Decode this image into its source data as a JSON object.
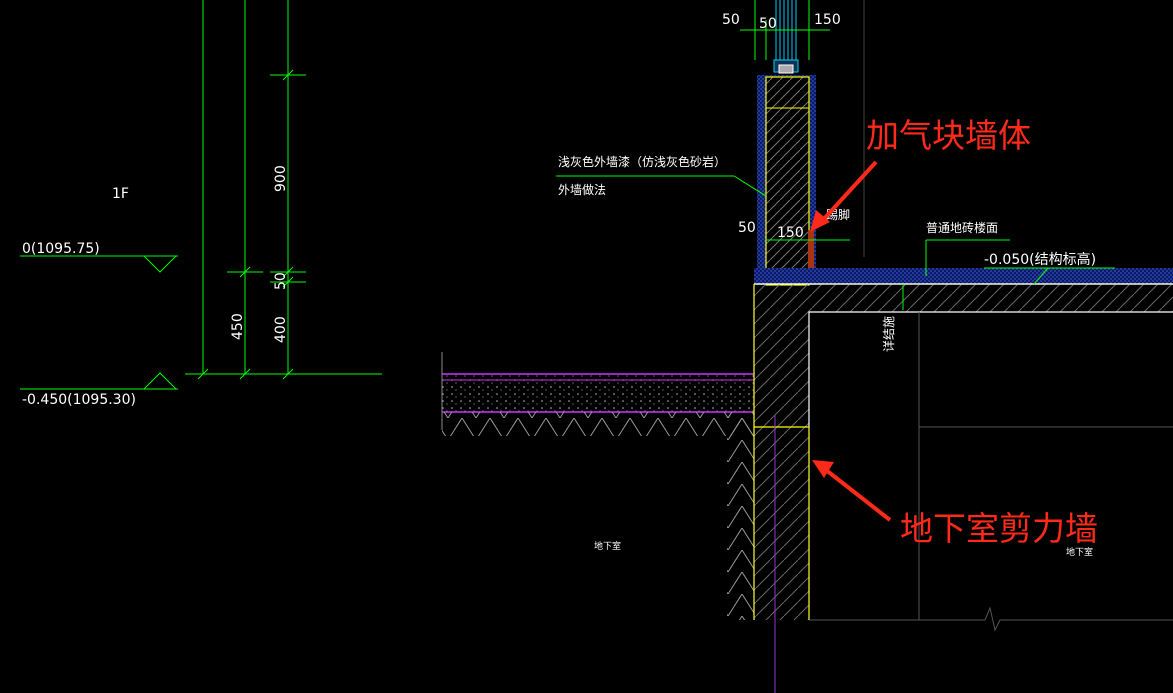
{
  "drawing": {
    "floor_label": "1F",
    "elev_top": "0(1095.75)",
    "elev_bottom": "-0.450(1095.30)",
    "dim_900": "900",
    "dim_50_left": "50",
    "dim_400": "400",
    "dim_450": "450",
    "dim_top_50a": "50",
    "dim_top_50b": "50",
    "dim_top_150": "150",
    "dim_50_mid": "50",
    "dim_150_mid": "150",
    "note_paint": "浅灰色外墙漆（仿浅灰色砂岩）",
    "note_wall_method": "外墙做法",
    "note_skirting": "踢脚",
    "note_floor": "普通地砖楼面",
    "elev_struct": "-0.050(结构标高)",
    "note_structure": "详结施",
    "room_basement_left": "地下室",
    "room_basement_right": "地下室"
  },
  "annotations": {
    "aerated_block_wall": "加气块墙体",
    "basement_shear_wall": "地下室剪力墙"
  },
  "colors": {
    "background": "#000000",
    "dimension_green": "#00ff00",
    "wall_yellow": "#ffff00",
    "finish_blue": "#1a3cff",
    "slab_magenta": "#cc33ff",
    "annotation_red": "#ff2a1a",
    "axis_purple": "#9933cc"
  }
}
